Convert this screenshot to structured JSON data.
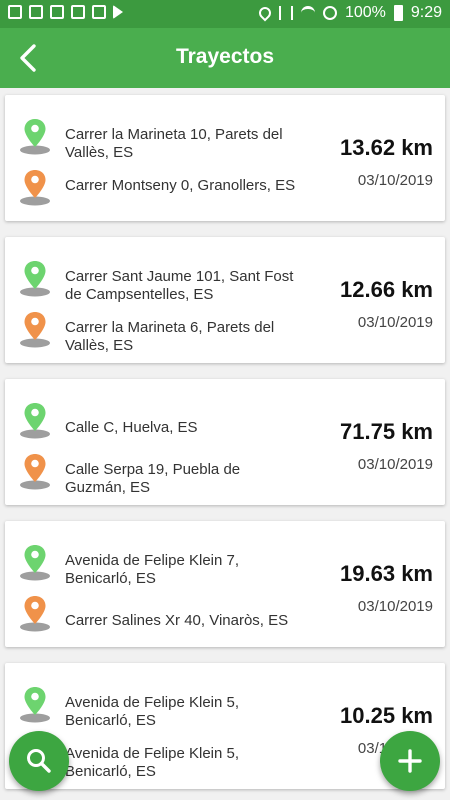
{
  "status_bar": {
    "battery": "100%",
    "time": "9:29",
    "icons": [
      "image-icon",
      "app-icon",
      "flipboard-icon",
      "news-icon",
      "calendar-icon",
      "play-icon"
    ],
    "right_icons": [
      "location-icon",
      "vibrate-icon",
      "wifi-icon",
      "dnd-icon",
      "battery-icon"
    ]
  },
  "header": {
    "title": "Trayectos",
    "back_icon": "arrow-back-icon"
  },
  "colors": {
    "primary": "#4aae4e",
    "status": "#3c9a3f",
    "origin_pin": "#6dd46f",
    "destination_pin": "#f0924a"
  },
  "trips": [
    {
      "origin": "Carrer la Marineta 10, Parets del Vallès, ES",
      "destination": "Carrer Montseny 0, Granollers, ES",
      "distance": "13.62 km",
      "date": "03/10/2019"
    },
    {
      "origin": "Carrer Sant Jaume 101, Sant Fost de Campsentelles, ES",
      "destination": "Carrer la Marineta 6, Parets del Vallès, ES",
      "distance": "12.66 km",
      "date": "03/10/2019"
    },
    {
      "origin": "Calle C, Huelva, ES",
      "destination": "Calle Serpa 19, Puebla de Guzmán, ES",
      "distance": "71.75 km",
      "date": "03/10/2019"
    },
    {
      "origin": "Avenida de Felipe Klein 7, Benicarló, ES",
      "destination": "Carrer Salines Xr 40, Vinaròs, ES",
      "distance": "19.63 km",
      "date": "03/10/2019"
    },
    {
      "origin": "Avenida de Felipe Klein 5, Benicarló, ES",
      "destination": "Avenida de Felipe Klein 5, Benicarló, ES",
      "distance": "10.25 km",
      "date": "03/10/2019"
    }
  ],
  "fabs": {
    "search_icon": "search-icon",
    "add_icon": "plus-icon"
  }
}
